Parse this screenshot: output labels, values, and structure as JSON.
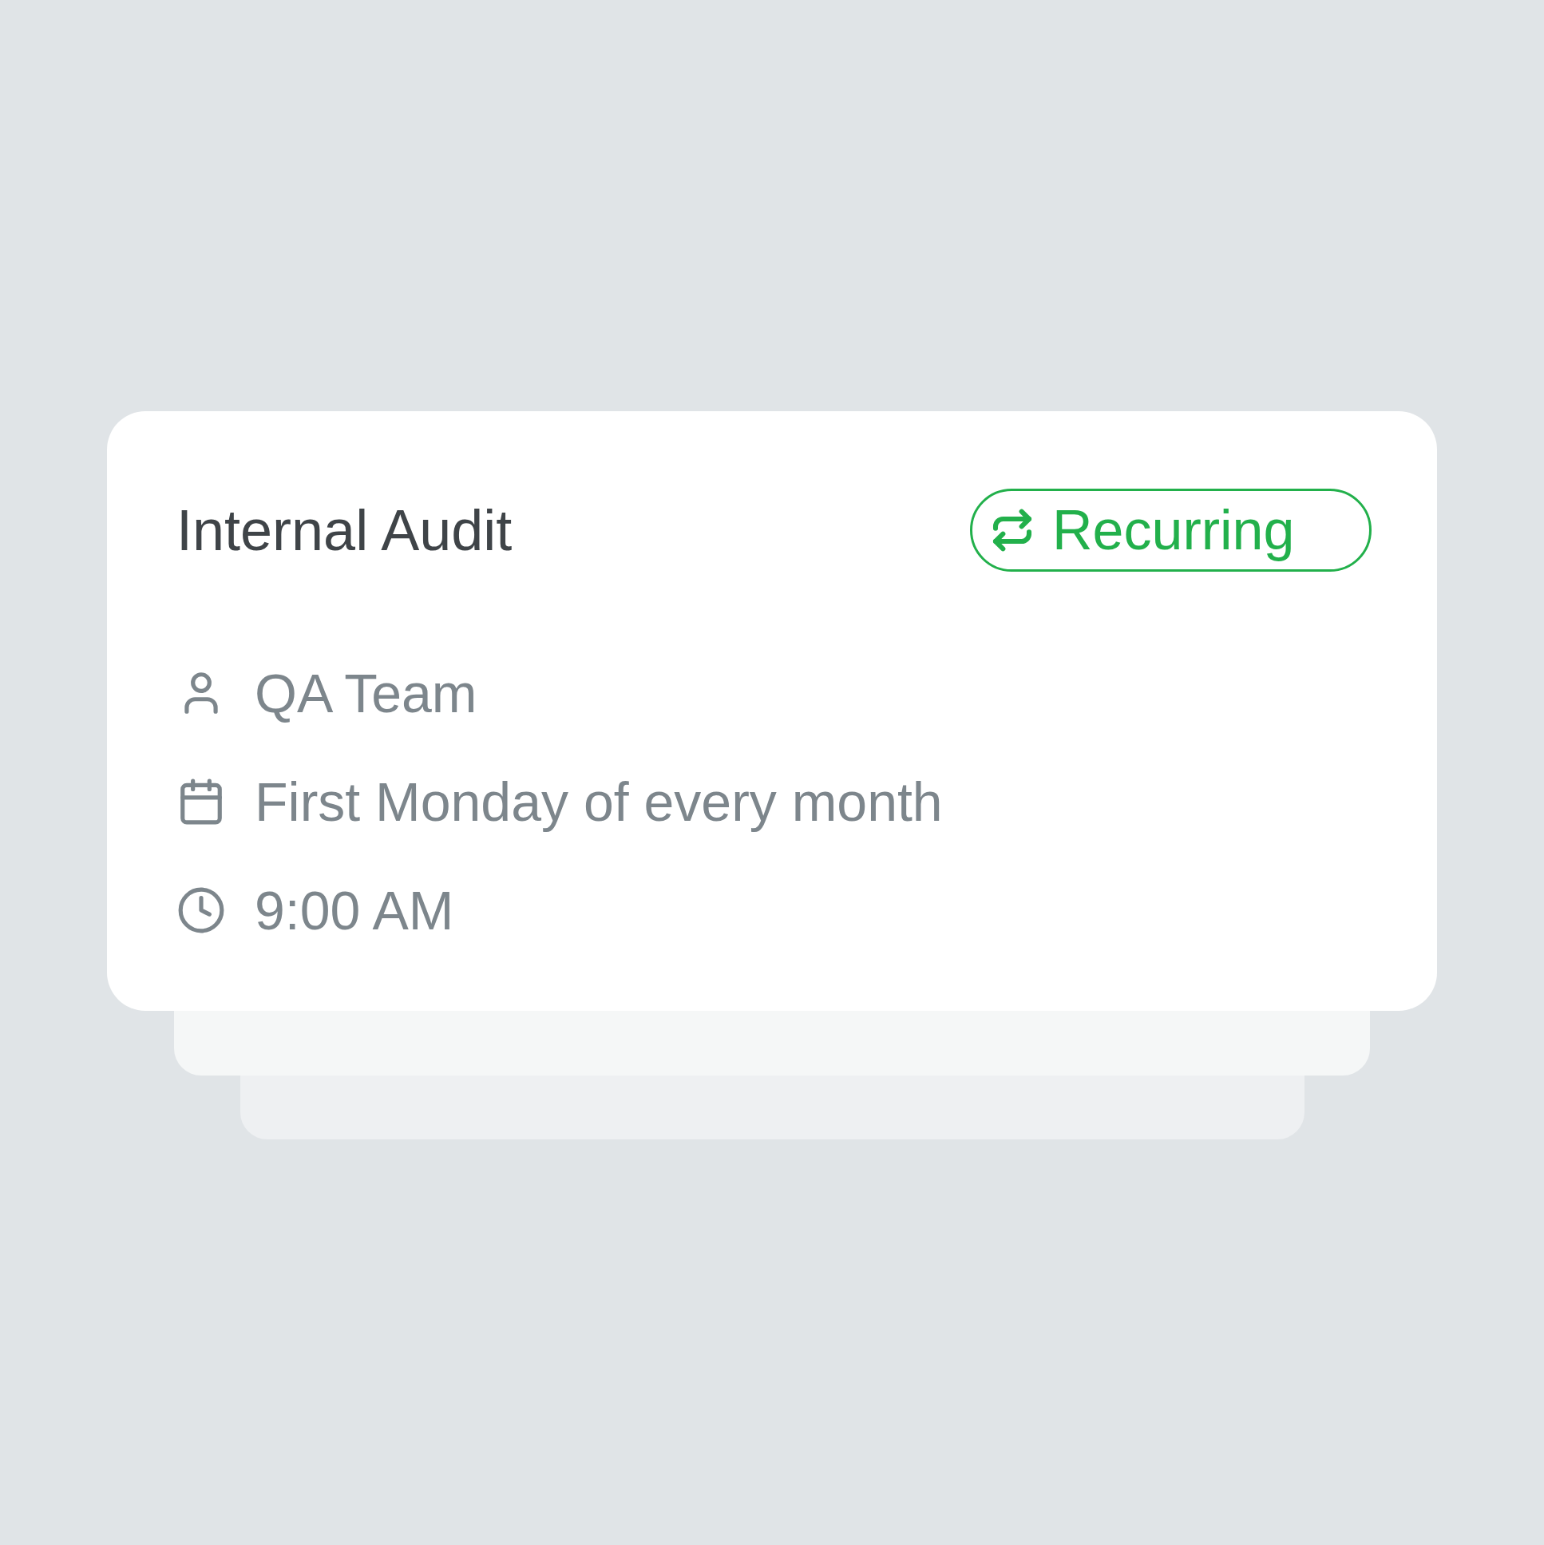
{
  "card": {
    "title": "Internal Audit",
    "badge": {
      "label": "Recurring"
    },
    "details": [
      {
        "kind": "team",
        "text": "QA Team"
      },
      {
        "kind": "schedule",
        "text": "First Monday of every month"
      },
      {
        "kind": "time",
        "text": "9:00 AM"
      }
    ]
  }
}
